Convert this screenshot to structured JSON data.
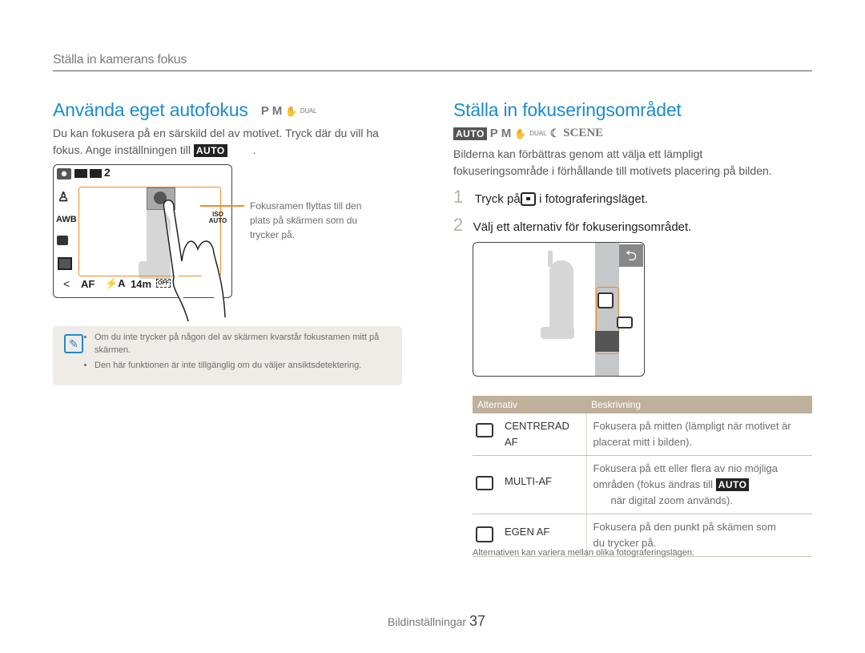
{
  "section_header": "Ställa in kamerans fokus",
  "left": {
    "title": "Använda eget autofokus",
    "modes": [
      "P",
      "M"
    ],
    "mode_dual": "DUAL",
    "intro_line1": "Du kan fokusera på en särskild del av motivet. Tryck där du vill ha",
    "intro_line2": "fokus. Ange inställningen till",
    "auto_badge": "AUTO",
    "intro_end": ".",
    "camera_screen": {
      "top_icons": [
        "mode-icon",
        "battery-icon",
        "storage-icon"
      ],
      "shot_count": "2",
      "awb": "AWB",
      "iso": "ISO AUTO",
      "bottom_back": "<",
      "bottom_af": "AF",
      "bottom_flash": "⚡A",
      "bottom_size": "14m",
      "bottom_face": "OFF"
    },
    "callout": "Fokusramen flyttas till den plats på skärmen som du trycker på.",
    "callout_lines": [
      "Fokusramen flyttas till den",
      "plats på skärmen som du",
      "trycker på."
    ],
    "notes": [
      "Om du inte trycker på någon del av skärmen kvarstår fokusramen mitt på skärmen.",
      "Den här funktionen är inte tillgänglig om du väljer ansiktsdetektering."
    ]
  },
  "right": {
    "title": "Ställa in fokuseringsområdet",
    "auto_badge": "AUTO",
    "modes": [
      "P",
      "M"
    ],
    "mode_dual": "DUAL",
    "mode_scene": "SCENE",
    "intro_line1": "Bilderna kan förbättras genom att välja ett lämpligt",
    "intro_line2": "fokuseringsområde i förhållande till motivets placering på bilden.",
    "steps": [
      {
        "num": "1",
        "before": "Tryck på",
        "after": "i fotograferingsläget."
      },
      {
        "num": "2",
        "text": "Välj ett alternativ för fokuseringsområdet."
      }
    ],
    "table": {
      "headers": [
        "Alternativ",
        "Beskrivning"
      ],
      "rows": [
        {
          "icon": "center-af-icon",
          "name_line1": "CENTRERAD",
          "name_line2": "AF",
          "desc_line1": "Fokusera på mitten (lämpligt när motivet är",
          "desc_line2": "placerat mitt i bilden)."
        },
        {
          "icon": "multi-af-icon",
          "name_line1": "MULTI-AF",
          "desc_line1": "Fokusera på ett eller flera av nio möjliga",
          "desc_line2_before": "områden (fokus ändras till",
          "desc_badge": "AUTO",
          "desc_line3": "när digital zoom används)."
        },
        {
          "icon": "touch-af-icon",
          "name_line1": "EGEN AF",
          "desc_line1": "Fokusera på den punkt på skämen som",
          "desc_line2": "du trycker på."
        }
      ]
    },
    "table_note": "Alternativen kan variera mellan olika fotograferingslägen."
  },
  "footer": {
    "label": "Bildinställningar",
    "page": "37"
  },
  "colors": {
    "accent_blue": "#1a8bd0",
    "focus_orange": "#f08a2a",
    "table_header": "#bfb09c",
    "note_bg": "#efebe6"
  }
}
